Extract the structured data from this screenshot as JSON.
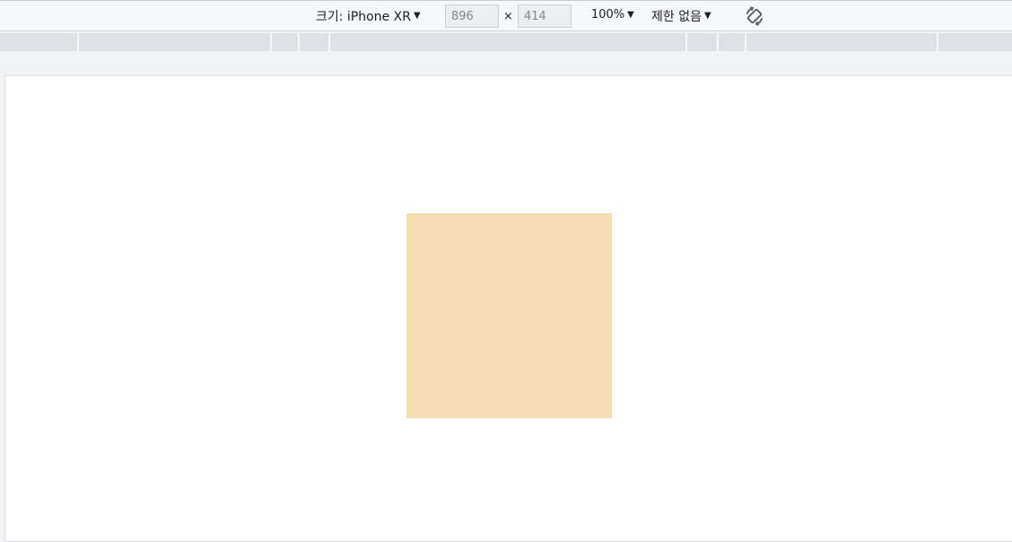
{
  "toolbar": {
    "device_label": "크기: iPhone XR",
    "width_value": "896",
    "height_value": "414",
    "dimension_separator": "×",
    "zoom_label": "100%",
    "throttle_label": "제한 없음",
    "caret_icon": "triangle-down-icon",
    "rotate_icon": "rotate-icon"
  },
  "viewport": {
    "box_color": "#f5deb3",
    "background": "#ffffff"
  }
}
